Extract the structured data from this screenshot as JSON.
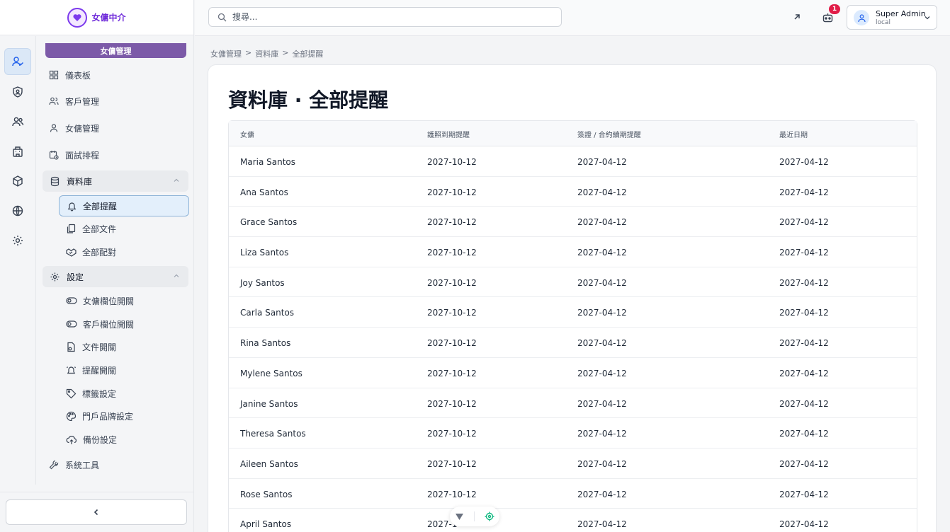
{
  "brand": {
    "name": "女傭中介"
  },
  "sidebar": {
    "section_title": "女傭管理",
    "items": [
      {
        "label": "儀表板"
      },
      {
        "label": "客戶管理"
      },
      {
        "label": "女傭管理"
      },
      {
        "label": "面試排程"
      }
    ],
    "database_group": {
      "label": "資料庫",
      "sub_items": [
        {
          "label": "全部提醒"
        },
        {
          "label": "全部文件"
        },
        {
          "label": "全部配對"
        }
      ]
    },
    "settings_group": {
      "label": "設定",
      "sub_items": [
        {
          "label": "女傭欄位開關"
        },
        {
          "label": "客戶欄位開關"
        },
        {
          "label": "文件開關"
        },
        {
          "label": "提醒開關"
        },
        {
          "label": "標籤設定"
        },
        {
          "label": "門戶品牌設定"
        },
        {
          "label": "備份設定"
        }
      ]
    },
    "tools": {
      "label": "系統工具"
    }
  },
  "header": {
    "search_placeholder": "搜尋...",
    "notification_count": "1",
    "user": {
      "name": "Super Admin",
      "sub": "local"
    }
  },
  "breadcrumb": [
    "女傭管理",
    ">",
    "資料庫",
    ">",
    "全部提醒"
  ],
  "page_title": "資料庫 · 全部提醒",
  "table": {
    "columns": [
      "女傭",
      "護照到期提醒",
      "簽證 / 合約續期提醒",
      "最近日期"
    ],
    "rows": [
      [
        "Maria Santos",
        "2027-10-12",
        "2027-04-12",
        "2027-04-12"
      ],
      [
        "Ana Santos",
        "2027-10-12",
        "2027-04-12",
        "2027-04-12"
      ],
      [
        "Grace Santos",
        "2027-10-12",
        "2027-04-12",
        "2027-04-12"
      ],
      [
        "Liza Santos",
        "2027-10-12",
        "2027-04-12",
        "2027-04-12"
      ],
      [
        "Joy Santos",
        "2027-10-12",
        "2027-04-12",
        "2027-04-12"
      ],
      [
        "Carla Santos",
        "2027-10-12",
        "2027-04-12",
        "2027-04-12"
      ],
      [
        "Rina Santos",
        "2027-10-12",
        "2027-04-12",
        "2027-04-12"
      ],
      [
        "Mylene Santos",
        "2027-10-12",
        "2027-04-12",
        "2027-04-12"
      ],
      [
        "Janine Santos",
        "2027-10-12",
        "2027-04-12",
        "2027-04-12"
      ],
      [
        "Theresa Santos",
        "2027-10-12",
        "2027-04-12",
        "2027-04-12"
      ],
      [
        "Aileen Santos",
        "2027-10-12",
        "2027-04-12",
        "2027-04-12"
      ],
      [
        "Rose Santos",
        "2027-10-12",
        "2027-04-12",
        "2027-04-12"
      ],
      [
        "April Santos",
        "2027-1",
        "2027-04-12",
        "2027-04-12"
      ]
    ]
  },
  "colors": {
    "accent": "#7c5aa8",
    "active_bg": "#e3effb",
    "badge": "#e11d48"
  },
  "icons": [
    "user-check-icon",
    "shield-user-icon",
    "users-icon",
    "building-icon",
    "box-icon",
    "globe-icon",
    "gear-icon",
    "search-icon",
    "arrow-up-right-icon",
    "robot-icon",
    "chevron-down-icon",
    "chevron-left-icon"
  ]
}
